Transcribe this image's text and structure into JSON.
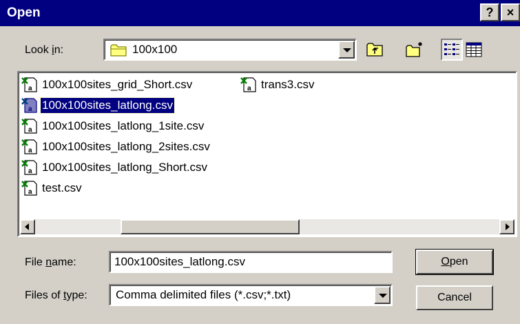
{
  "window": {
    "title": "Open",
    "help_label": "?",
    "close_label": "×"
  },
  "look_in": {
    "label_prefix": "Look ",
    "label_accel": "i",
    "label_suffix": "n:",
    "value": "100x100",
    "icon": "folder-icon"
  },
  "toolbar": {
    "buttons": [
      {
        "name": "up-one-level",
        "icon": "up-folder-icon"
      },
      {
        "name": "create-new-folder",
        "icon": "new-folder-icon"
      },
      {
        "name": "list-view",
        "icon": "list-view-icon",
        "pressed": true
      },
      {
        "name": "details-view",
        "icon": "details-view-icon",
        "pressed": false
      }
    ]
  },
  "files": [
    {
      "name": "100x100sites_grid_Short.csv",
      "selected": false
    },
    {
      "name": "100x100sites_latlong.csv",
      "selected": true
    },
    {
      "name": "100x100sites_latlong_1site.csv",
      "selected": false
    },
    {
      "name": "100x100sites_latlong_2sites.csv",
      "selected": false
    },
    {
      "name": "100x100sites_latlong_Short.csv",
      "selected": false
    },
    {
      "name": "test.csv",
      "selected": false
    },
    {
      "name": "trans3.csv",
      "selected": false
    }
  ],
  "file_name": {
    "label_prefix": "File ",
    "label_accel": "n",
    "label_suffix": "ame:",
    "value": "100x100sites_latlong.csv"
  },
  "file_type": {
    "label_prefix": "Files of ",
    "label_accel": "t",
    "label_suffix": "ype:",
    "value": "Comma delimited files (*.csv;*.txt)"
  },
  "buttons": {
    "open_accel": "O",
    "open_rest": "pen",
    "cancel": "Cancel"
  },
  "colors": {
    "titlebar": "#000080",
    "face": "#d4d0c8",
    "selection": "#000080"
  }
}
